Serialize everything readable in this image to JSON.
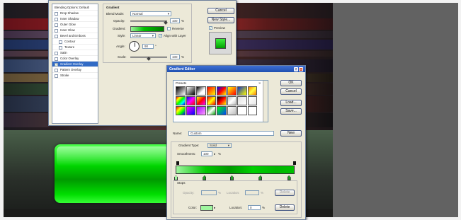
{
  "layer_style": {
    "buttons": {
      "cancel": "Cancel",
      "new_style": "New Style...",
      "preview": "Preview"
    },
    "style_list": [
      {
        "label": "Blending Options: Default",
        "checked": false,
        "header": true,
        "selected": false
      },
      {
        "label": "Drop Shadow",
        "checked": false,
        "selected": false
      },
      {
        "label": "Inner Shadow",
        "checked": false,
        "selected": false
      },
      {
        "label": "Outer Glow",
        "checked": false,
        "selected": false
      },
      {
        "label": "Inner Glow",
        "checked": false,
        "selected": false
      },
      {
        "label": "Bevel and Emboss",
        "checked": false,
        "selected": false
      },
      {
        "label": "Contour",
        "checked": false,
        "selected": false,
        "indent": true
      },
      {
        "label": "Texture",
        "checked": false,
        "selected": false,
        "indent": true
      },
      {
        "label": "Satin",
        "checked": false,
        "selected": false
      },
      {
        "label": "Color Overlay",
        "checked": false,
        "selected": false
      },
      {
        "label": "Gradient Overlay",
        "checked": true,
        "selected": true
      },
      {
        "label": "Pattern Overlay",
        "checked": false,
        "selected": false
      },
      {
        "label": "Stroke",
        "checked": false,
        "selected": false
      }
    ],
    "gradient_panel": {
      "title": "Gradient",
      "blend_mode_label": "Blend Mode:",
      "blend_mode_value": "Normal",
      "opacity_label": "Opacity:",
      "opacity_value": "100",
      "opacity_unit": "%",
      "gradient_label": "Gradient:",
      "reverse_label": "Reverse",
      "style_label": "Style:",
      "style_value": "Linear",
      "align_label": "Align with Layer",
      "angle_label": "Angle:",
      "angle_value": "90",
      "angle_unit": "°",
      "scale_label": "Scale:",
      "scale_value": "100",
      "scale_unit": "%"
    }
  },
  "gradient_editor": {
    "title": "Gradient Editor",
    "presets_label": "Presets",
    "buttons": {
      "ok": "OK",
      "cancel": "Cancel",
      "load": "Load...",
      "save": "Save...",
      "new": "New",
      "delete": "Delete",
      "delete_disabled": "Delete"
    },
    "name_label": "Name:",
    "name_value": "Custom",
    "gradient_type_label": "Gradient Type:",
    "gradient_type_value": "Solid",
    "smoothness_label": "Smoothness:",
    "smoothness_value": "100",
    "smoothness_unit": "%",
    "stops_label": "Stops",
    "opacity_label": "Opacity:",
    "opacity_unit": "%",
    "location_label": "Location:",
    "location_unit": "%",
    "color_label": "Color:",
    "color_location_label": "Location:",
    "color_location_value": "0",
    "color_location_unit": "%",
    "presets": [
      "linear-gradient(135deg,#000,#fff)",
      "linear-gradient(135deg,#fff,#000)",
      "linear-gradient(135deg,#000,#fff 60%,#fff)",
      "linear-gradient(135deg,#ff0000,#ffff00)",
      "linear-gradient(135deg,#0000ff,#ff0000,#ffff00)",
      "linear-gradient(135deg,#ffff00,#ff8000,#ff0000)",
      "linear-gradient(135deg,#1030c0,#ffff00)",
      "linear-gradient(135deg,#ff8000,#ffff40,#ff8000)",
      "linear-gradient(135deg,#ff0000,#ffff00,#00ff00,#00ffff,#0000ff)",
      "linear-gradient(135deg,#0000ff,#ff00ff,#ff0000)",
      "linear-gradient(135deg,#ffff00,#ff0000,#ff00ff)",
      "linear-gradient(135deg,#ff0000,#ffff00,#ff0000)",
      "linear-gradient(135deg,#000,#ff0000,#ffff00)",
      "linear-gradient(135deg,#c0c0c0,#fff,#c0c0c0)",
      "linear-gradient(135deg,#e0e0e0,#fff)",
      "linear-gradient(135deg,#fff,#e8e8e8)",
      "linear-gradient(135deg,#ff0000,#ffff00,#00ff00,#0000ff)",
      "linear-gradient(135deg,#ff00ff,#0000ff)",
      "linear-gradient(135deg,#a000ff,#ffa0ff)",
      "linear-gradient(135deg,#00a000,#fff,#00a000)",
      "linear-gradient(135deg,#00ff00,#0040ff)",
      "linear-gradient(135deg,#fff,#c0c0c0)",
      "linear-gradient(135deg,#fff,#fff)",
      "linear-gradient(135deg,#fff,#fff)"
    ],
    "stop_positions": [
      0,
      24,
      47,
      71,
      95
    ],
    "active_color": "#9ff59f"
  },
  "canvas": {
    "bar_color": "#00d800"
  }
}
